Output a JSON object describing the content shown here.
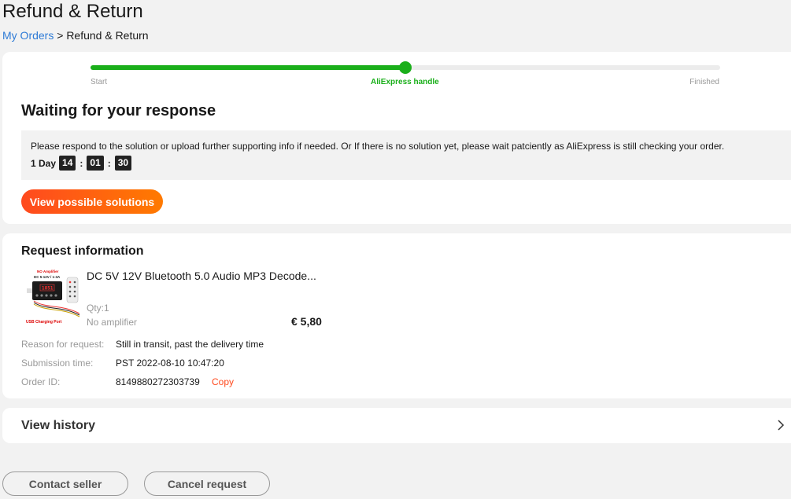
{
  "header": {
    "title": "Refund & Return",
    "breadcrumb": {
      "link": "My Orders",
      "separator": ">",
      "current": "Refund & Return"
    }
  },
  "progress": {
    "steps": [
      "Start",
      "AliExpress handle",
      "Finished"
    ],
    "current_step": 1,
    "fill_fraction": 0.5,
    "active_color": "#1aaf1a"
  },
  "status": {
    "heading": "Waiting for your response",
    "notice": "Please respond to the solution or upload further supporting info if needed. Or If there is no solution yet, please wait patciently as AliExpress is still checking your order.",
    "countdown": {
      "day": "1 Day",
      "hours": "14",
      "minutes": "01",
      "seconds": "30",
      "sep": ":"
    },
    "solutions_button": "View possible solutions"
  },
  "request": {
    "heading": "Request information",
    "product": {
      "title": "DC 5V 12V Bluetooth 5.0 Audio MP3 Decode...",
      "qty": "Qty:1",
      "variant": "No amplifier",
      "price": "€ 5,80",
      "thumb_labels": {
        "top": "NO Amplifier",
        "spec": "DC 5-12V / 1-3A",
        "bottom": "USB Charging Port"
      }
    },
    "rows": [
      {
        "key": "Reason for request:",
        "value": "Still in transit, past the delivery time"
      },
      {
        "key": "Submission time:",
        "value": "PST 2022-08-10 10:47:20"
      },
      {
        "key": "Order ID:",
        "value": "8149880272303739",
        "action": "Copy"
      }
    ]
  },
  "history": {
    "label": "View history"
  },
  "actions": {
    "contact": "Contact seller",
    "cancel": "Cancel request"
  },
  "colors": {
    "accent": "#ff4a1f",
    "link": "#2e7bd6",
    "success": "#1aaf1a"
  }
}
